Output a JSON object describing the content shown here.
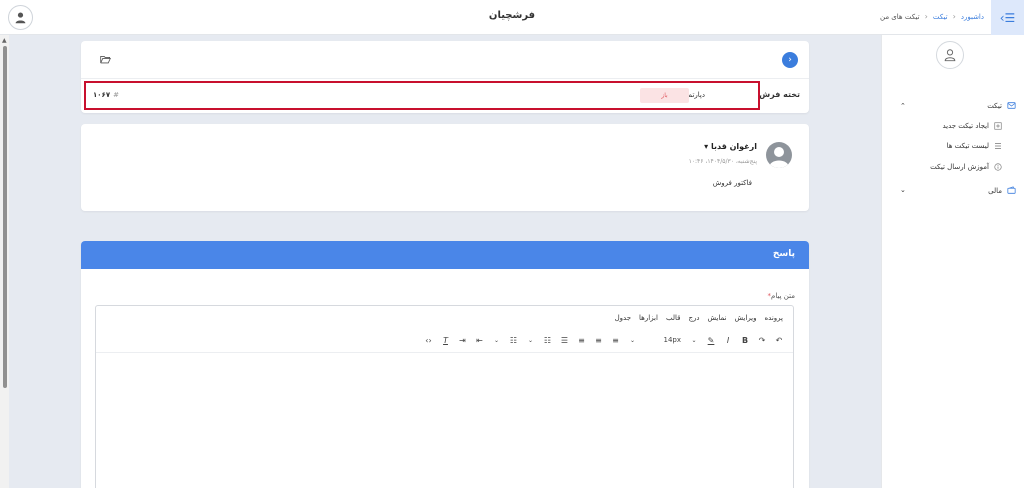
{
  "header": {
    "app_title": "فرشچیان",
    "breadcrumb": [
      "داشبورد",
      "تیکت",
      "تیکت های من"
    ]
  },
  "sidebar": {
    "ticket_group": "تیکت",
    "sub_items": [
      "ایجاد تیکت جدید",
      "لیست تیکت ها",
      "آموزش ارسال تیکت"
    ],
    "finance_group": "مالی"
  },
  "ticket": {
    "board_name": "تخته فرش",
    "department": "دپارتمان پشتیبانی",
    "status": "باز",
    "number": "۱۰۶۷",
    "status_color": "#e0565e"
  },
  "message": {
    "author": "ارغوان قدبا",
    "date": "پنج‌شنبه، ۱۴۰۴/۵/۳۰، ۱۰:۴۶",
    "body": "فاکتور فروش"
  },
  "reply": {
    "title": "پاسخ",
    "field_label": "متن پیام",
    "menu": [
      "پرونده",
      "ویرایش",
      "نمایش",
      "درج",
      "قالب",
      "ابزارها",
      "جدول"
    ],
    "font_size": "14px"
  },
  "colors": {
    "accent": "#3b7ddd",
    "reply_header": "#4a86e8"
  }
}
